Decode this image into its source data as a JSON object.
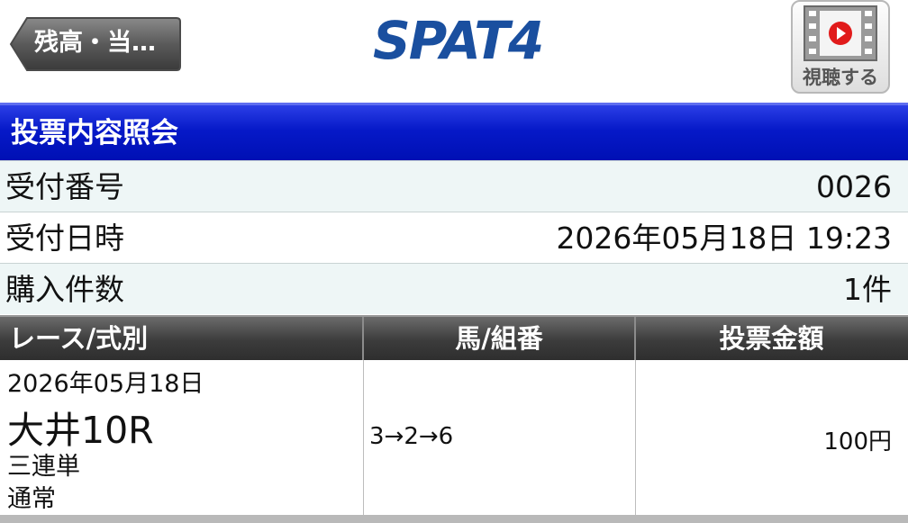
{
  "header": {
    "back_label": "残高・当…",
    "logo_text": "SPAT4",
    "watch_label": "視聴する",
    "brand_color": "#1a4f9f",
    "icons": [
      "back-arrow-icon",
      "film-play-icon"
    ]
  },
  "title": "投票内容照会",
  "info": {
    "receipt_no_label": "受付番号",
    "receipt_no": "0026",
    "received_at_label": "受付日時",
    "received_at": "2026年05月18日 19:23",
    "count_label": "購入件数",
    "count": "1件"
  },
  "table": {
    "headers": {
      "race": "レース/式別",
      "combo": "馬/組番",
      "amount": "投票金額"
    },
    "rows": [
      {
        "date": "2026年05月18日",
        "race": "大井10R",
        "bet_type": "三連単",
        "mode": "通常",
        "combo": "3→2→6",
        "amount": "100円"
      }
    ]
  },
  "colors": {
    "title_band": "#0619c8",
    "table_header": "#3c3c3c",
    "row_tint": "#eef6f6"
  }
}
